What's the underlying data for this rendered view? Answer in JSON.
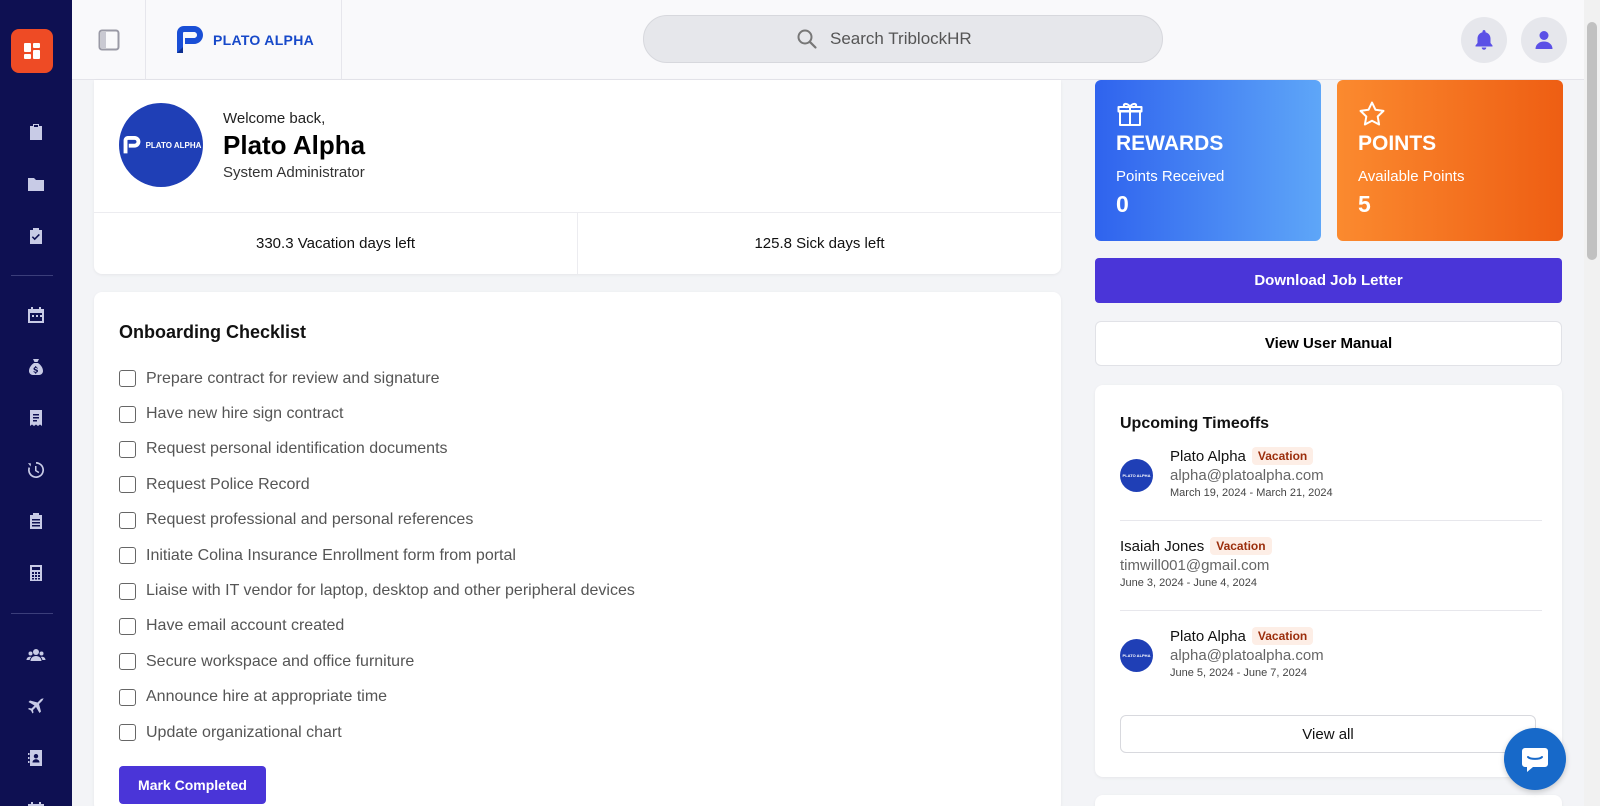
{
  "header": {
    "logo_text": "PLATO ALPHA",
    "search_placeholder": "Search TriblockHR"
  },
  "profile": {
    "welcome": "Welcome back,",
    "name": "Plato Alpha",
    "role": "System Administrator",
    "avatar_text": "PLATO ALPHA",
    "vacation_days": "330.3 Vacation days left",
    "sick_days": "125.8 Sick days left"
  },
  "checklist": {
    "title": "Onboarding Checklist",
    "items": [
      "Prepare contract for review and signature",
      "Have new hire sign contract",
      "Request personal identification documents",
      "Request Police Record",
      "Request professional and personal references",
      "Initiate Colina Insurance Enrollment form from portal",
      "Liaise with IT vendor for laptop, desktop and other peripheral devices",
      "Have email account created",
      "Secure workspace and office furniture",
      "Announce hire at appropriate time",
      "Update organizational chart"
    ],
    "button_label": "Mark Completed"
  },
  "rewards": {
    "title": "REWARDS",
    "subtitle": "Points Received",
    "value": "0",
    "color_start": "#2f63ee",
    "color_end": "#5ea6f8"
  },
  "points": {
    "title": "POINTS",
    "subtitle": "Available Points",
    "value": "5",
    "color_start": "#fb8a2f",
    "color_end": "#ee5e13"
  },
  "actions": {
    "download_job_letter": "Download Job Letter",
    "view_user_manual": "View User Manual"
  },
  "timeoffs": {
    "title": "Upcoming Timeoffs",
    "entries": [
      {
        "name": "Plato Alpha",
        "type": "Vacation",
        "email": "alpha@platoalpha.com",
        "dates": "March 19, 2024 - March 21, 2024",
        "avatar_text": "PLATO ALPHA"
      },
      {
        "name": "Isaiah Jones",
        "type": "Vacation",
        "email": "timwill001@gmail.com",
        "dates": "June 3, 2024 - June 4, 2024"
      },
      {
        "name": "Plato Alpha",
        "type": "Vacation",
        "email": "alpha@platoalpha.com",
        "dates": "June 5, 2024 - June 7, 2024",
        "avatar_text": "PLATO ALPHA"
      }
    ],
    "view_all": "View all"
  },
  "colors": {
    "sidebar_bg": "#0e1052",
    "accent": "#4a35d8",
    "home_active": "#ee4b25",
    "brand_blue": "#1749c9"
  },
  "sidebar": {
    "icons": [
      "dashboard-icon",
      "clipboard-icon",
      "folder-icon",
      "clipboard-check-icon",
      "calendar-icon",
      "money-bag-icon",
      "receipt-icon",
      "history-icon",
      "clipboard-list-icon",
      "calculator-icon",
      "users-icon",
      "plane-icon",
      "contact-card-icon"
    ]
  }
}
